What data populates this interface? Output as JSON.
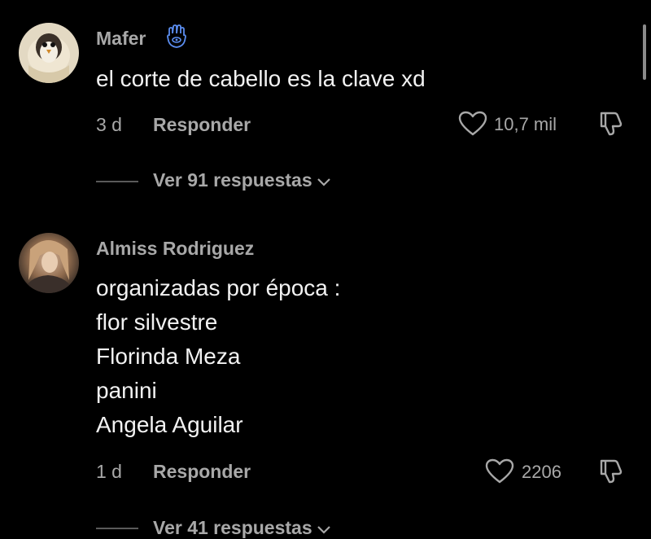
{
  "comments": [
    {
      "username": "Mafer",
      "badge_icon": "hamsa-hand-icon",
      "avatar_icon": "penguin-avatar",
      "text_lines": [
        "el corte de cabello es la clave xd"
      ],
      "time": "3 d",
      "reply_label": "Responder",
      "like_count": "10,7 mil",
      "view_replies_label": "Ver 91 respuestas"
    },
    {
      "username": "Almiss Rodriguez",
      "avatar_icon": "photo-avatar",
      "text_lines": [
        "organizadas por época :",
        "flor silvestre",
        "Florinda Meza",
        "panini",
        "Angela Aguilar"
      ],
      "time": "1 d",
      "reply_label": "Responder",
      "like_count": "2206",
      "view_replies_label": "Ver 41 respuestas"
    }
  ],
  "colors": {
    "background": "#000000",
    "secondary_text": "#a8a8a8",
    "primary_text": "#f2f2f2",
    "badge_blue": "#5b8def"
  }
}
